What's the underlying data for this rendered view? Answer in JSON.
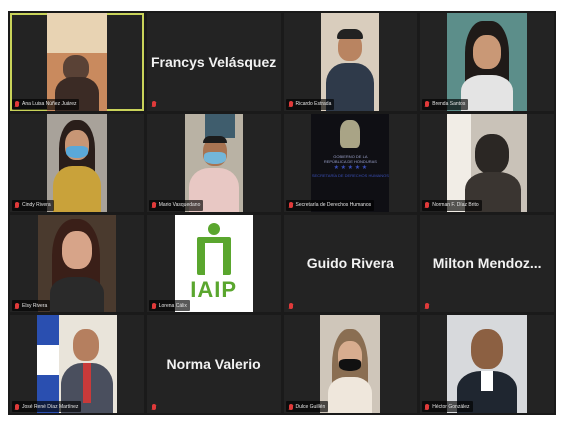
{
  "meeting": {
    "participants": [
      {
        "name": "Ana Luisa Núñez Juárez",
        "type": "video"
      },
      {
        "name": "Francys Velásquez",
        "type": "name_only"
      },
      {
        "name": "Ricardo Estrada",
        "type": "video"
      },
      {
        "name": "Brenda Santos",
        "type": "video"
      },
      {
        "name": "Cindy Rivera",
        "type": "video"
      },
      {
        "name": "Mario Vasquedano",
        "type": "video"
      },
      {
        "name": "Secretaría de Derechos Humanos",
        "type": "logo",
        "logo_lines": [
          "GOBIERNO DE LA",
          "REPÚBLICA DE HONDURAS",
          "SECRETARÍA DE DERECHOS HUMANOS"
        ]
      },
      {
        "name": "Norman F. Díaz Brito",
        "type": "video"
      },
      {
        "name": "Elsy Rivera",
        "type": "video"
      },
      {
        "name": "Lorena Cálix",
        "type": "logo",
        "logo_text": "IAIP"
      },
      {
        "name": "Guido Rivera",
        "type": "name_only"
      },
      {
        "name": "Milton Mendoz...",
        "type": "name_only"
      },
      {
        "name": "José René Díaz Martínez",
        "type": "video"
      },
      {
        "name": "Norma Valerio",
        "type": "name_only"
      },
      {
        "name": "Dulce Guillén",
        "type": "video"
      },
      {
        "name": "Héctor González",
        "type": "video"
      }
    ]
  },
  "colors": {
    "tile_bg": "#232323",
    "active_border": "#c9d35a",
    "mic_muted": "#e03a3a",
    "iaip_green": "#5aa62e",
    "sdh_blue": "#3a4fb8"
  }
}
